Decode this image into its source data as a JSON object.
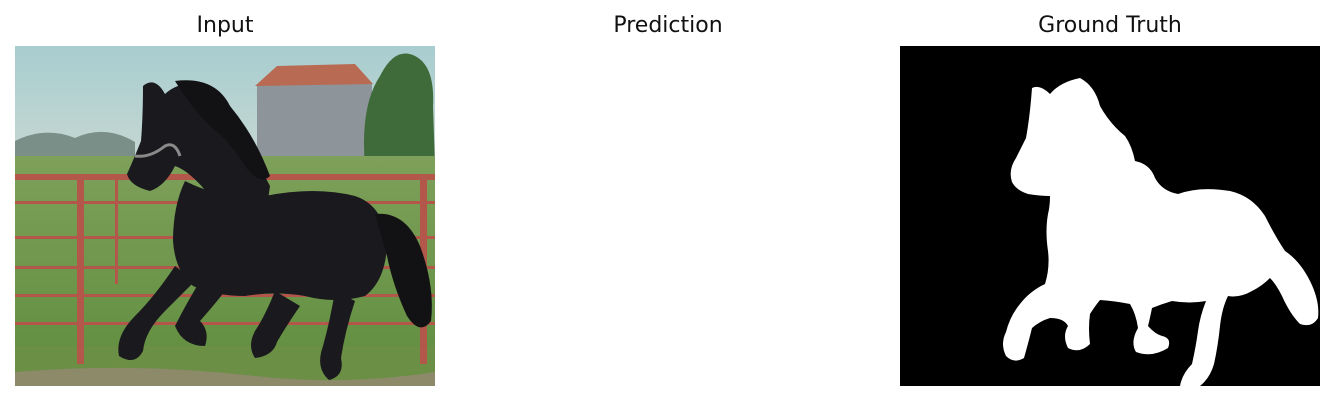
{
  "panels": [
    {
      "title": "Input"
    },
    {
      "title": "Prediction"
    },
    {
      "title": "Ground Truth"
    }
  ],
  "colors": {
    "background": "#ffffff",
    "mask_background": "#000000",
    "mask_foreground": "#ffffff",
    "sky": "#9fc3c6",
    "grass": "#6f9a4a",
    "fence": "#b2574a",
    "horse": "#1a1a1e"
  }
}
